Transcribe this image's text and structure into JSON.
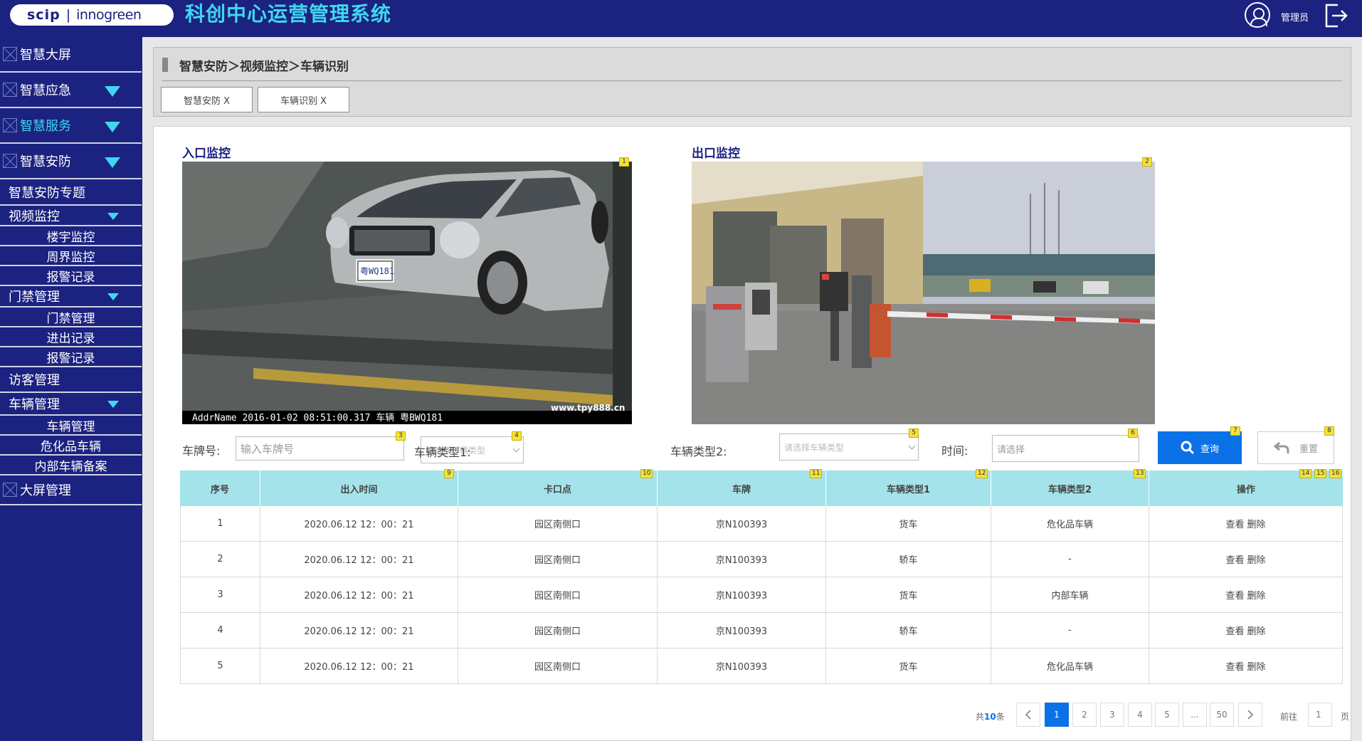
{
  "header": {
    "logo_left": "scip",
    "logo_sep": "|",
    "logo_right": "innogreen",
    "app_title": "科创中心运营管理系统",
    "user_name": "管理员"
  },
  "sidebar": {
    "items": [
      {
        "label": "智慧大屏"
      },
      {
        "label": "智慧应急"
      },
      {
        "label": "智慧服务"
      },
      {
        "label": "智慧安防"
      },
      {
        "label": "智慧安防专题"
      },
      {
        "label": "视频监控"
      },
      {
        "label": "楼宇监控"
      },
      {
        "label": "周界监控"
      },
      {
        "label": "报警记录"
      },
      {
        "label": "门禁管理"
      },
      {
        "label": "门禁管理"
      },
      {
        "label": "进出记录"
      },
      {
        "label": "报警记录"
      },
      {
        "label": "访客管理"
      },
      {
        "label": "车辆管理"
      },
      {
        "label": "车辆管理"
      },
      {
        "label": "危化品车辆"
      },
      {
        "label": "内部车辆备案"
      },
      {
        "label": "大屏管理"
      }
    ]
  },
  "breadcrumb": "智慧安防＞视频监控＞车辆识别",
  "tabs": [
    {
      "label": "智慧安防 X"
    },
    {
      "label": "车辆识别 X"
    }
  ],
  "monitors": {
    "entry_title": "入口监控",
    "exit_title": "出口监控",
    "entry_overlay": "AddrName 2016-01-02 08:51:00.317 车辆 粤BWQ181",
    "entry_watermark": "www.tpy888.cn",
    "entry_plate_text": "粤WQ181"
  },
  "filters": {
    "plate_label": "车牌号:",
    "plate_placeholder": "输入车牌号",
    "type1_label": "车辆类型1:",
    "type1_placeholder": "请选择车辆类型",
    "type2_label": "车辆类型2:",
    "type2_placeholder": "请选择车辆类型",
    "time_label": "时间:",
    "time_placeholder": "请选择",
    "query_label": "查询",
    "reset_label": "重置"
  },
  "badges": [
    "1",
    "2",
    "3",
    "4",
    "5",
    "6",
    "7",
    "8",
    "9",
    "10",
    "11",
    "12",
    "13",
    "14",
    "15",
    "16"
  ],
  "table": {
    "headers": [
      "序号",
      "出入时间",
      "卡口点",
      "车牌",
      "车辆类型1",
      "车辆类型2",
      "操作"
    ],
    "view_label": "查看",
    "delete_label": "删除",
    "rows": [
      {
        "no": "1",
        "time": "2020.06.12 12：00：21",
        "gate": "园区南侧口",
        "plate": "京N100393",
        "type1": "货车",
        "type2": "危化品车辆"
      },
      {
        "no": "2",
        "time": "2020.06.12 12：00：21",
        "gate": "园区南侧口",
        "plate": "京N100393",
        "type1": "轿车",
        "type2": "-"
      },
      {
        "no": "3",
        "time": "2020.06.12 12：00：21",
        "gate": "园区南侧口",
        "plate": "京N100393",
        "type1": "货车",
        "type2": "内部车辆"
      },
      {
        "no": "4",
        "time": "2020.06.12 12：00：21",
        "gate": "园区南侧口",
        "plate": "京N100393",
        "type1": "轿车",
        "type2": "-"
      },
      {
        "no": "5",
        "time": "2020.06.12 12：00：21",
        "gate": "园区南侧口",
        "plate": "京N100393",
        "type1": "货车",
        "type2": "危化品车辆"
      }
    ]
  },
  "pagination": {
    "total_prefix": "共",
    "total_count": "10",
    "total_suffix": "条",
    "pages": [
      "1",
      "2",
      "3",
      "4",
      "5",
      "...",
      "50"
    ],
    "current": "1",
    "goto_label": "前往",
    "goto_value": "1",
    "page_suffix": "页"
  },
  "colors": {
    "nav_bg": "#1b227f",
    "accent_cyan": "#3fd7f0",
    "primary_blue": "#0a72e6",
    "table_header": "#a4e3e9"
  }
}
